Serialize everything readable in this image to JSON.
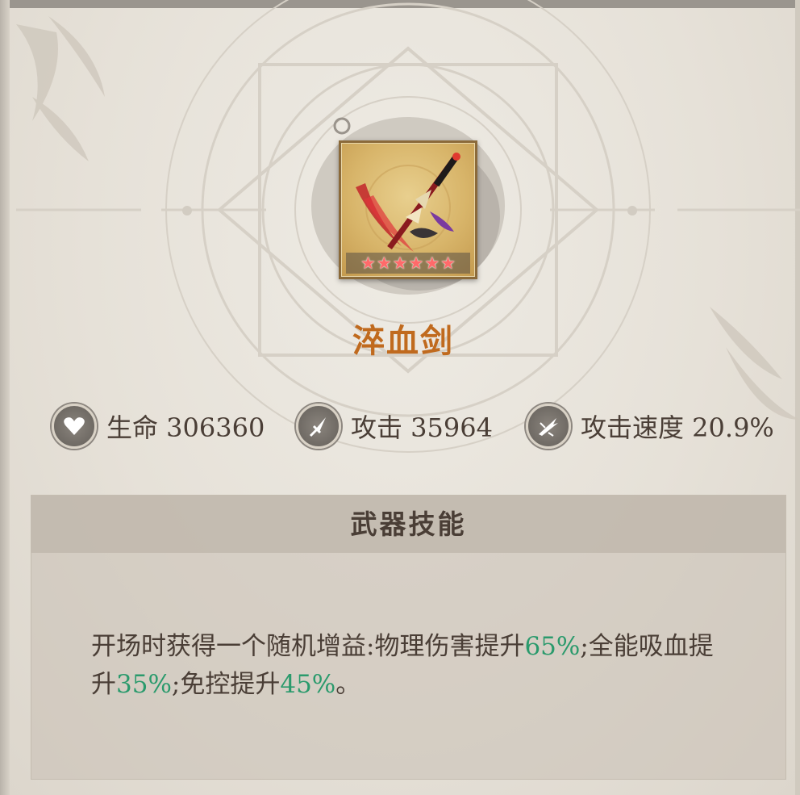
{
  "item": {
    "name": "淬血剑",
    "star_count": 6,
    "star_glyph": "★"
  },
  "stats": [
    {
      "icon": "heart-icon",
      "label": "生命 306360"
    },
    {
      "icon": "dagger-icon",
      "label": "攻击 35964"
    },
    {
      "icon": "slash-icon",
      "label": "攻击速度 20.9%"
    }
  ],
  "skill": {
    "title": "武器技能",
    "desc_parts": [
      "开场时获得一个随机增益:物理伤害提升",
      "65%",
      ";全能吸血提升",
      "35%",
      ";免控提升",
      "45%",
      "。"
    ]
  },
  "colors": {
    "name": "#c06a1e",
    "highlight": "#2a9a6c",
    "text": "#4a3e36",
    "star": "#ff6a6a"
  }
}
